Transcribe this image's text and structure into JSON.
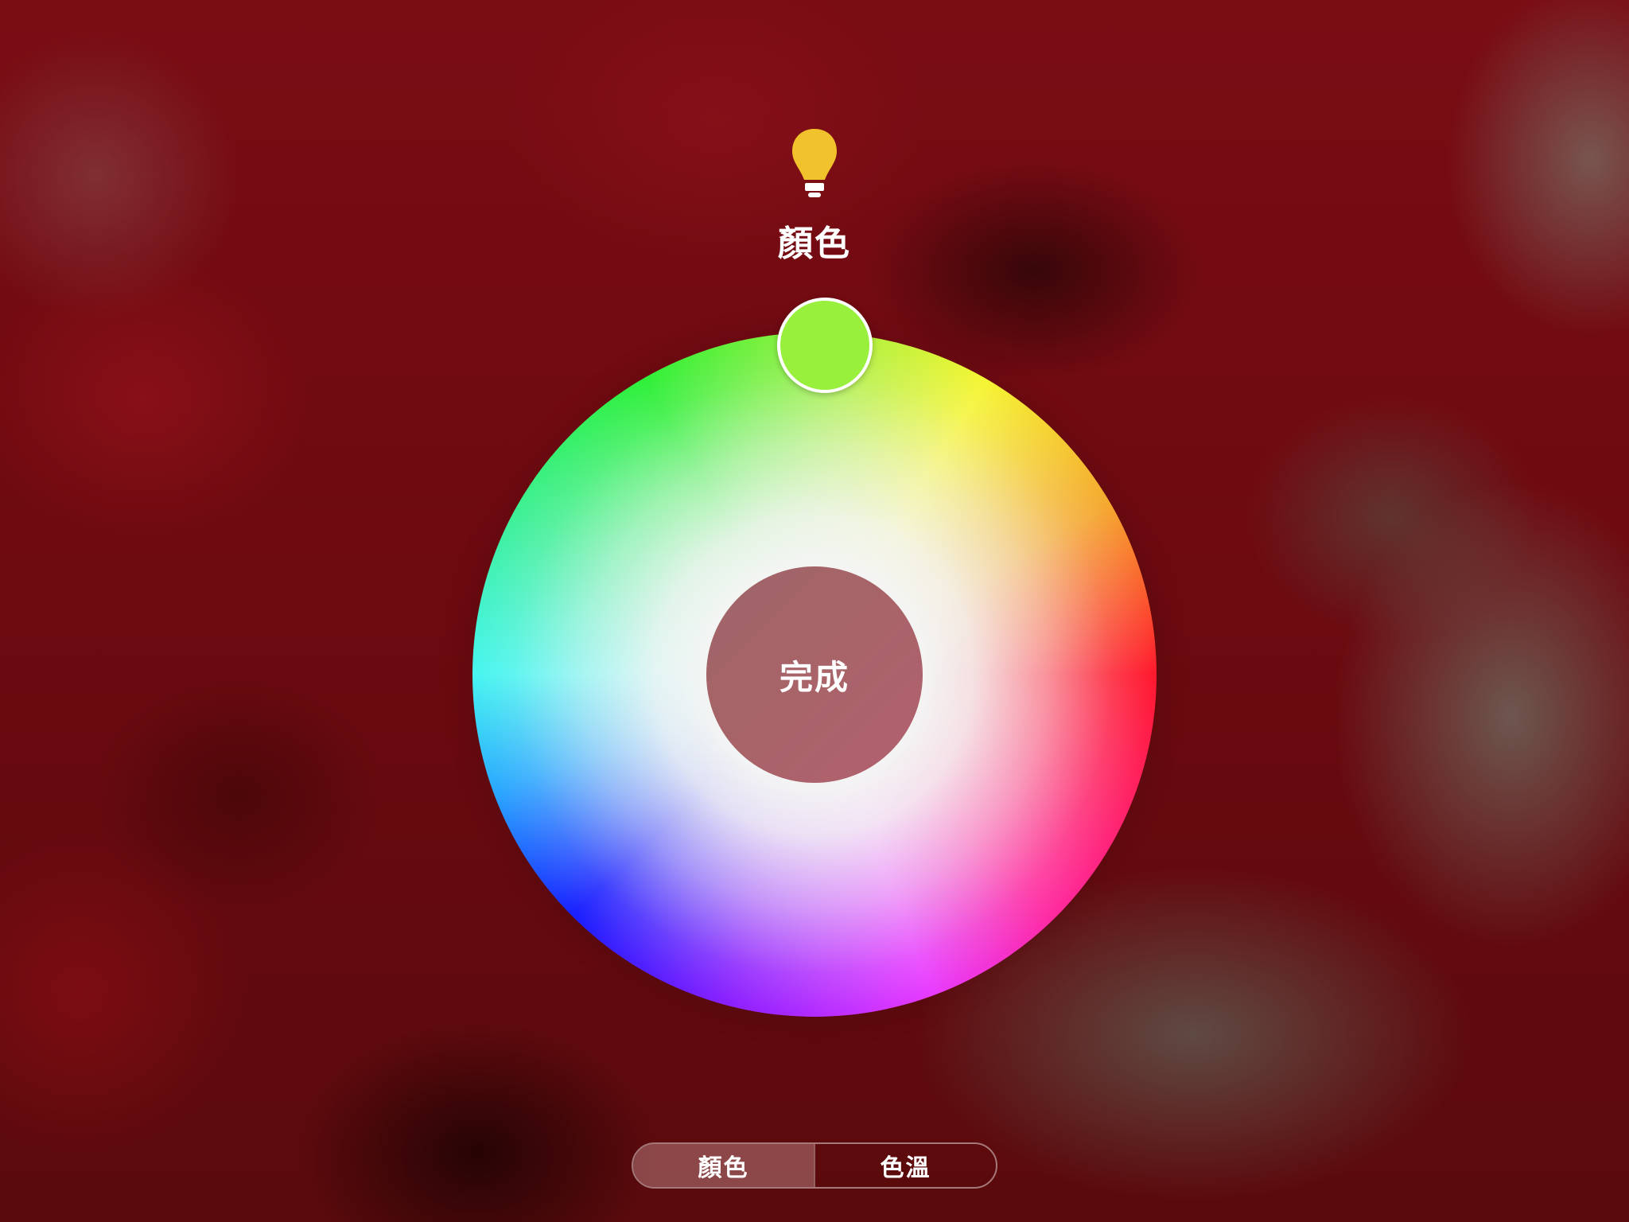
{
  "header": {
    "icon": "lightbulb-icon",
    "title": "顏色"
  },
  "wheel": {
    "center_label": "完成",
    "selected_color": "#98f03c"
  },
  "segmented": {
    "items": [
      {
        "label": "顏色",
        "active": true
      },
      {
        "label": "色溫",
        "active": false
      }
    ]
  },
  "colors": {
    "bulb": "#f2c22c",
    "done_button": "#a86468"
  }
}
